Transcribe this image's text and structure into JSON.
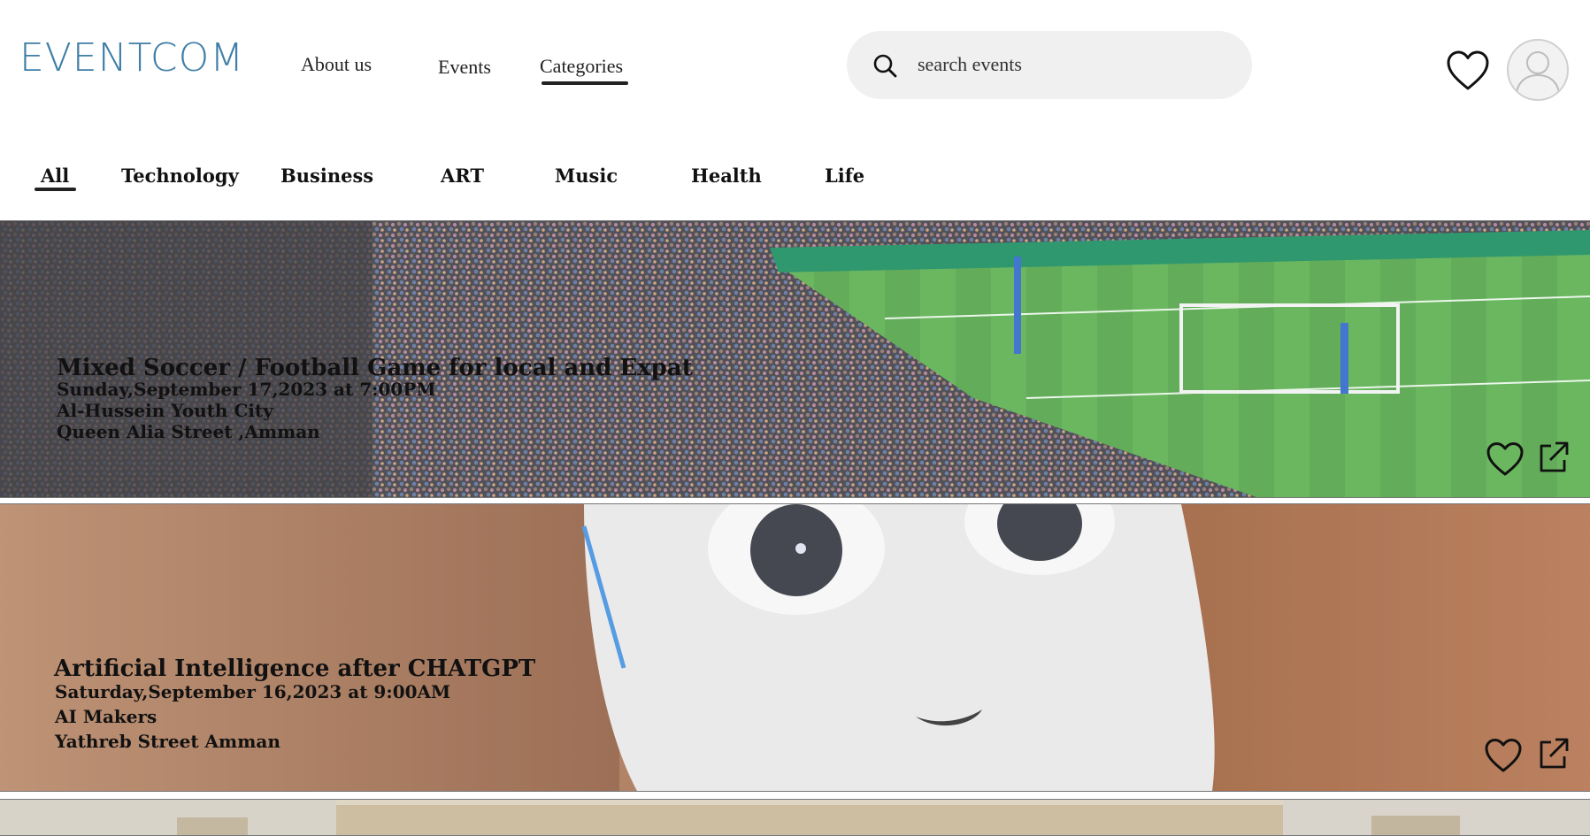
{
  "header": {
    "logo": "EVENTCOM",
    "nav": {
      "about": "About us",
      "events": "Events",
      "categories": "Categories"
    },
    "search": {
      "placeholder": "search events",
      "icon": "search-icon"
    },
    "favorites_icon": "heart-icon",
    "profile_icon": "user-avatar-icon"
  },
  "tabs": [
    "All",
    "Technology",
    "Business",
    "ART",
    "Music",
    "Health",
    "Life"
  ],
  "active_tab": "All",
  "events": [
    {
      "title": "Mixed Soccer / Football Game  for local and  Expat",
      "datetime": "Sunday,September 17,2023 at 7:00PM",
      "venue": "Al-Hussein Youth City",
      "address": "Queen Alia Street ,Amman",
      "image": "soccer-stadium-photo"
    },
    {
      "title": "Artificial Intelligence after CHATGPT",
      "datetime": "Saturday,September 16,2023 at 9:00AM",
      "venue": "AI Makers",
      "address": "Yathreb Street Amman",
      "image": "robot-photo"
    },
    {
      "image": "ruins-photo"
    }
  ],
  "colors": {
    "logo": "#3f7ea6",
    "search_bg": "#f0f0f0",
    "text": "#111111"
  }
}
